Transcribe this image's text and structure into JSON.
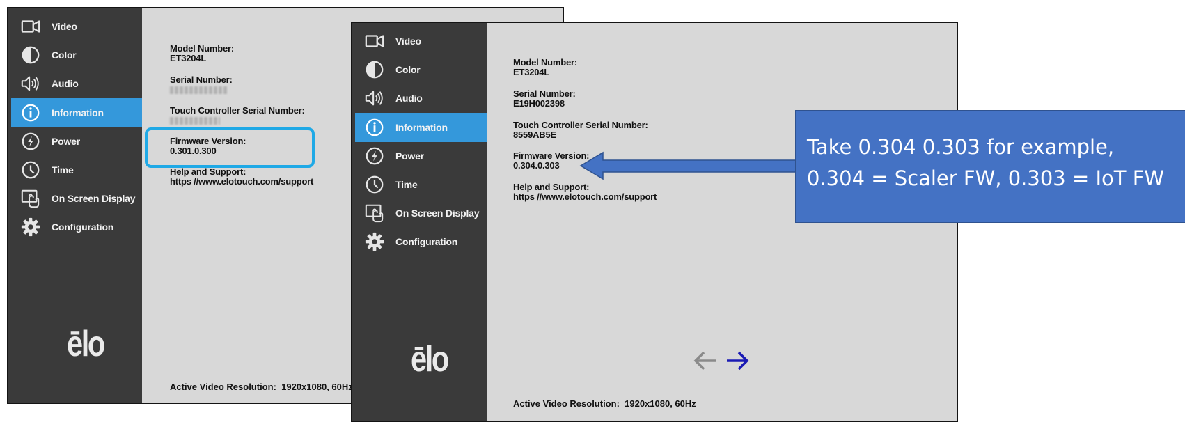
{
  "left_screen": {
    "menu": [
      {
        "label": "Video",
        "icon": "video-icon"
      },
      {
        "label": "Color",
        "icon": "color-icon"
      },
      {
        "label": "Audio",
        "icon": "audio-icon"
      },
      {
        "label": "Information",
        "icon": "information-icon",
        "active": true
      },
      {
        "label": "Power",
        "icon": "power-icon"
      },
      {
        "label": "Time",
        "icon": "clock-icon"
      },
      {
        "label": "On Screen Display",
        "icon": "osd-icon"
      },
      {
        "label": "Configuration",
        "icon": "gear-icon"
      }
    ],
    "logo": "ēlo",
    "model_label": "Model Number:",
    "model_value": "ET3204L",
    "serial_label": "Serial Number:",
    "touch_label": "Touch Controller Serial Number:",
    "firmware_label": "Firmware Version:",
    "firmware_value": "0.301.0.300",
    "help_label": "Help and Support:",
    "help_value": "https //www.elotouch.com/support",
    "resolution_label": "Active Video Resolution:",
    "resolution_value": "1920x1080, 60Hz"
  },
  "right_screen": {
    "menu": [
      {
        "label": "Video",
        "icon": "video-icon"
      },
      {
        "label": "Color",
        "icon": "color-icon"
      },
      {
        "label": "Audio",
        "icon": "audio-icon"
      },
      {
        "label": "Information",
        "icon": "information-icon",
        "active": true
      },
      {
        "label": "Power",
        "icon": "power-icon"
      },
      {
        "label": "Time",
        "icon": "clock-icon"
      },
      {
        "label": "On Screen Display",
        "icon": "osd-icon"
      },
      {
        "label": "Configuration",
        "icon": "gear-icon"
      }
    ],
    "logo": "ēlo",
    "model_label": "Model Number:",
    "model_value": "ET3204L",
    "serial_label": "Serial Number:",
    "serial_value": "E19H002398",
    "touch_label": "Touch Controller Serial Number:",
    "touch_value": "8559AB5E",
    "firmware_label": "Firmware Version:",
    "firmware_value": "0.304.0.303",
    "help_label": "Help and Support:",
    "help_value": "https //www.elotouch.com/support",
    "resolution_label": "Active Video Resolution:",
    "resolution_value": "1920x1080, 60Hz"
  },
  "callout": {
    "line1": "Take 0.304 0.303 for example,",
    "line2": "0.304 = Scaler FW, 0.303 = IoT FW"
  },
  "colors": {
    "sidebar": "#3a3a3a",
    "active_item": "#3498db",
    "panel": "#d8d8d8",
    "highlight": "#1fa9e6",
    "callout": "#4472c4",
    "arrow_active": "#1a1ab4",
    "arrow_inactive": "#8a8a8a"
  }
}
